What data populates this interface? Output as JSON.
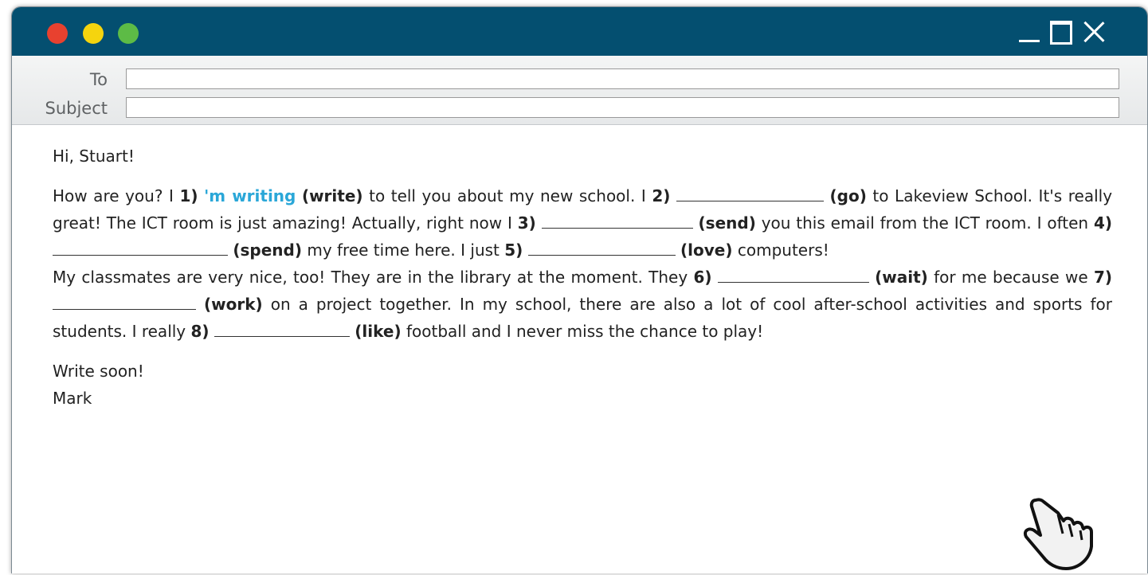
{
  "window": {
    "traffic_lights": {
      "close": "#e8412f",
      "minimize": "#f5d40e",
      "zoom": "#5dbb46"
    },
    "titlebar_color": "#044f70",
    "controls": [
      "minimize-icon",
      "maximize-icon",
      "close-icon"
    ]
  },
  "header": {
    "to_label": "To",
    "to_value": "",
    "subject_label": "Subject",
    "subject_value": ""
  },
  "email": {
    "greeting": "Hi, Stuart!",
    "p1": {
      "s1": "How are you? I ",
      "n1": "1)",
      "a1": "'m writing",
      "h1": "(write)",
      "s2": " to tell you about my new school. I ",
      "n2": "2)",
      "h2": "(go)",
      "s3": " to Lakeview School. It's really great! The ICT room is just amazing! Actually, right now I ",
      "n3": "3)",
      "h3": "(send)",
      "s4": " you this email from the ICT room. I often ",
      "n4": "4)",
      "h4": "(spend)",
      "s5": " my free time here. I just ",
      "n5": "5)",
      "h5": "(love)",
      "s6": " computers!"
    },
    "p2": {
      "s1": "My classmates are very nice, too! They are in the library at the moment. They ",
      "n6": "6)",
      "h6": "(wait)",
      "s2": " for me because we ",
      "n7": "7)",
      "h7": "(work)",
      "s3": " on a project together. In my school, there are also a lot of cool after-school activities and sports for students. I really ",
      "n8": "8)",
      "h8": "(like)",
      "s4": " football and I never miss the chance to play!"
    },
    "closing": "Write soon!",
    "signature": "Mark"
  },
  "accent_color": "#2aa7d8",
  "cursor_icon": "hand-pointer-icon"
}
